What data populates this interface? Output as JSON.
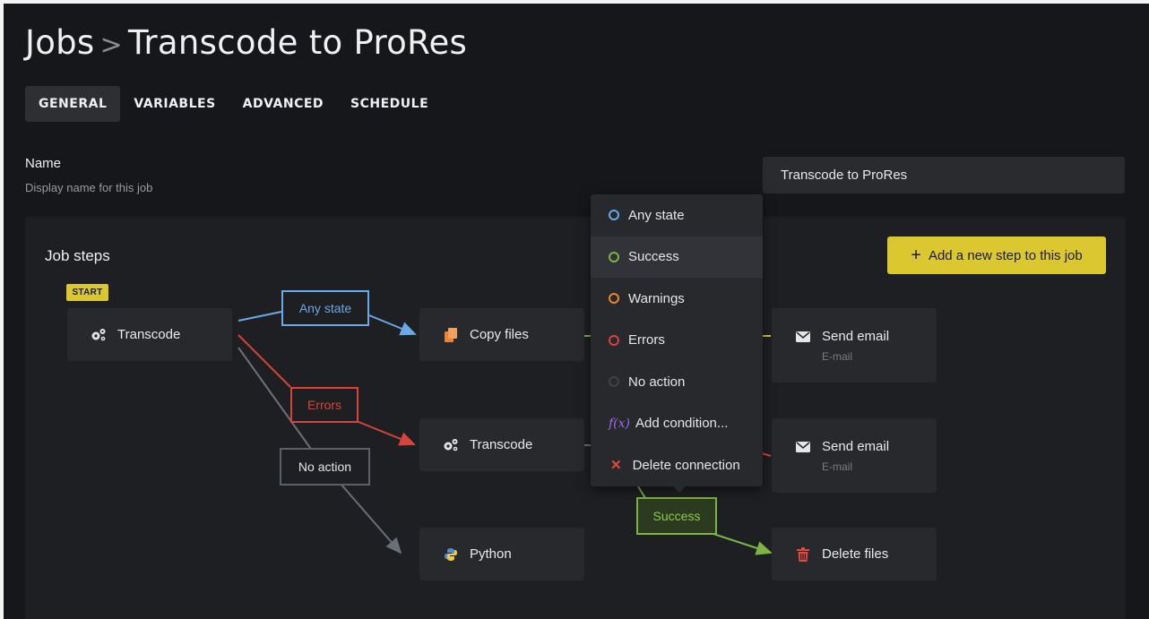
{
  "header": {
    "breadcrumb_root": "Jobs",
    "separator": ">",
    "current": "Transcode to ProRes"
  },
  "tabs": [
    {
      "label": "GENERAL",
      "active": true
    },
    {
      "label": "VARIABLES",
      "active": false
    },
    {
      "label": "ADVANCED",
      "active": false
    },
    {
      "label": "SCHEDULE",
      "active": false
    }
  ],
  "name_field": {
    "label": "Name",
    "help": "Display name for this job",
    "value": "Transcode to ProRes"
  },
  "job_steps": {
    "title": "Job steps",
    "add_button": "Add a new step to this job",
    "add_icon": "+",
    "start_badge": "START",
    "nodes": {
      "transcode_start": {
        "label": "Transcode",
        "icon": "gears-icon"
      },
      "copy_files": {
        "label": "Copy files",
        "icon": "files-icon"
      },
      "transcode_2": {
        "label": "Transcode",
        "icon": "gears-icon"
      },
      "python": {
        "label": "Python",
        "icon": "python-icon"
      },
      "send_email_1": {
        "label": "Send email",
        "sub": "E-mail",
        "icon": "envelope-icon"
      },
      "send_email_2": {
        "label": "Send email",
        "sub": "E-mail",
        "icon": "envelope-icon"
      },
      "delete_files": {
        "label": "Delete files",
        "icon": "trash-icon"
      }
    },
    "connections": {
      "any_state": "Any state",
      "errors": "Errors",
      "no_action": "No action",
      "success": "Success"
    }
  },
  "context_menu": {
    "items": [
      {
        "label": "Any state",
        "icon": "circle-blue-icon"
      },
      {
        "label": "Success",
        "icon": "circle-green-icon"
      },
      {
        "label": "Warnings",
        "icon": "circle-orange-icon"
      },
      {
        "label": "Errors",
        "icon": "circle-red-icon"
      },
      {
        "label": "No action",
        "icon": "circle-dark-icon"
      },
      {
        "label": "Add condition...",
        "icon": "fx-icon",
        "fx": "f(x)"
      },
      {
        "label": "Delete connection",
        "icon": "close-icon",
        "glyph": "✕"
      }
    ]
  },
  "colors": {
    "background": "#16171a",
    "panel": "#1e1f22",
    "node": "#28292c",
    "accent_yellow": "#dbc831",
    "any_state": "#6aa8e6",
    "errors": "#d8443c",
    "no_action": "#6b6f76",
    "success": "#7cb342",
    "warnings": "#e8833a",
    "fx": "#9b6bf0"
  }
}
